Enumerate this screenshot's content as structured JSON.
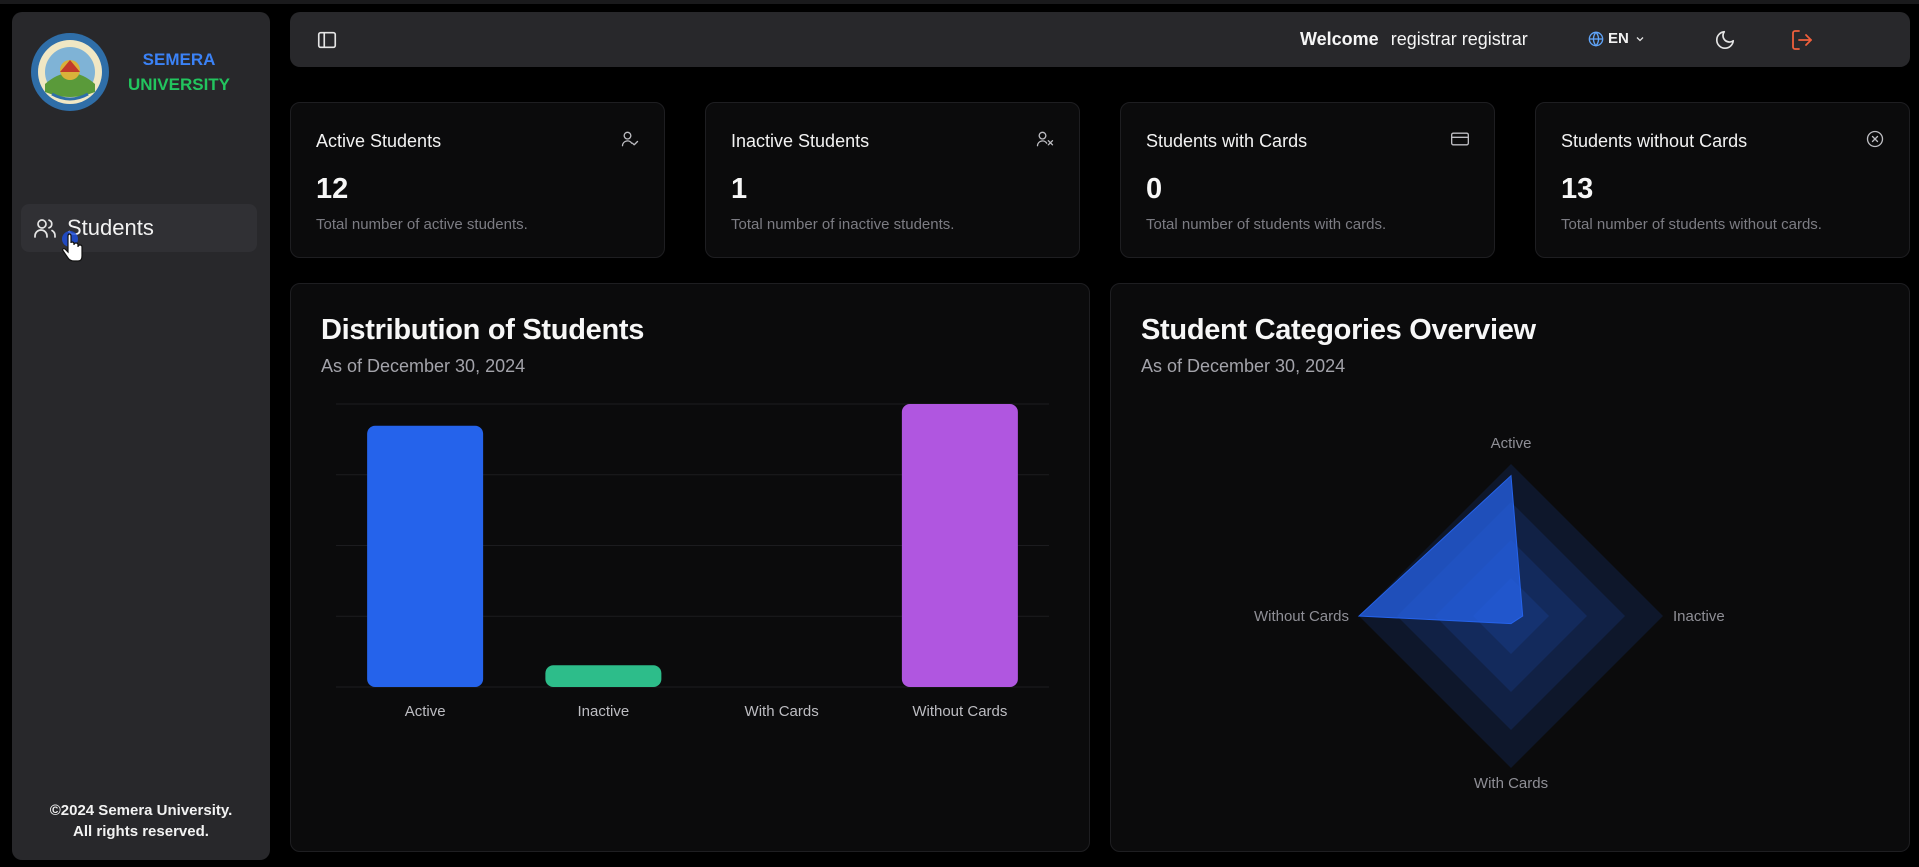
{
  "brand": {
    "line1": "SEMERA",
    "line2": "UNIVERSITY"
  },
  "sidebar": {
    "items": [
      {
        "label": "Students",
        "icon": "users-icon"
      }
    ]
  },
  "footer": {
    "line1": "©2024 Semera University.",
    "line2": "All rights reserved."
  },
  "header": {
    "welcome_label": "Welcome",
    "user_name": "registrar registrar",
    "language": "EN"
  },
  "stats": [
    {
      "title": "Active Students",
      "value": "12",
      "desc": "Total number of active students.",
      "icon": "user-check-icon"
    },
    {
      "title": "Inactive Students",
      "value": "1",
      "desc": "Total number of inactive students.",
      "icon": "user-x-icon"
    },
    {
      "title": "Students with Cards",
      "value": "0",
      "desc": "Total number of students with cards.",
      "icon": "credit-card-icon"
    },
    {
      "title": "Students without Cards",
      "value": "13",
      "desc": "Total number of students without cards.",
      "icon": "x-circle-icon"
    }
  ],
  "colors": {
    "active": "#2563eb",
    "inactive": "#2dbd8a",
    "without_cards": "#b056e0",
    "radar": "#2563eb",
    "logout": "#ef5f3c"
  },
  "chart_data": [
    {
      "type": "bar",
      "title": "Distribution of Students",
      "subtitle": "As of December 30, 2024",
      "categories": [
        "Active",
        "Inactive",
        "With Cards",
        "Without Cards"
      ],
      "values": [
        12,
        1,
        0,
        13
      ],
      "ylim": [
        0,
        13
      ],
      "grid": true,
      "colors": [
        "#2563eb",
        "#2dbd8a",
        "#6b7280",
        "#b056e0"
      ]
    },
    {
      "type": "radar",
      "title": "Student Categories Overview",
      "subtitle": "As of December 30, 2024",
      "categories": [
        "Active",
        "Inactive",
        "With Cards",
        "Without Cards"
      ],
      "values": [
        12,
        1,
        0,
        13
      ],
      "rlim": [
        0,
        13
      ],
      "rings": 4
    }
  ]
}
